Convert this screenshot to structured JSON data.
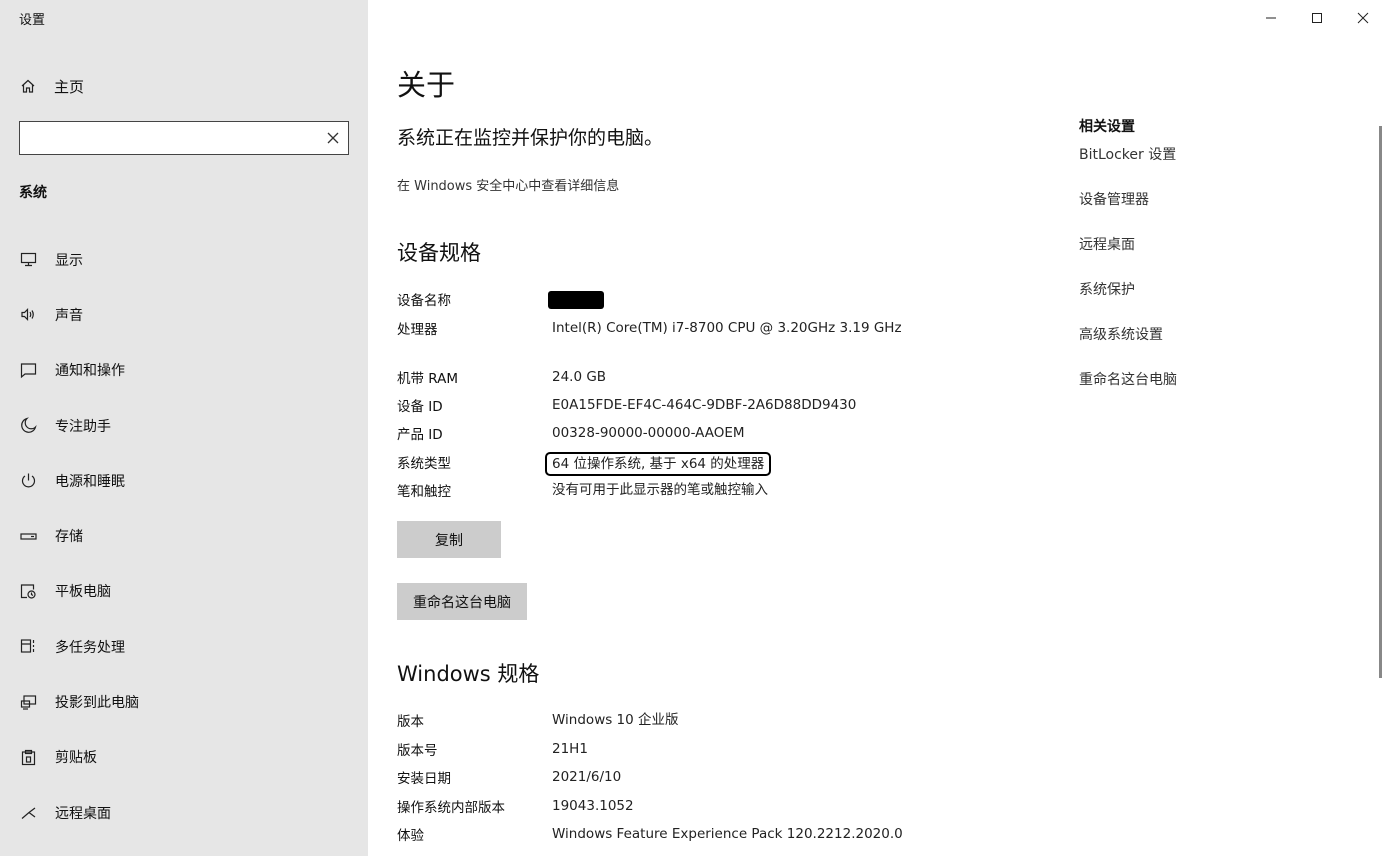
{
  "window": {
    "title": "设置"
  },
  "sidebar": {
    "home_label": "主页",
    "search_value": "",
    "section_title": "系统",
    "items": [
      {
        "label": "显示",
        "icon": "monitor-icon"
      },
      {
        "label": "声音",
        "icon": "speaker-icon"
      },
      {
        "label": "通知和操作",
        "icon": "notification-icon"
      },
      {
        "label": "专注助手",
        "icon": "moon-icon"
      },
      {
        "label": "电源和睡眠",
        "icon": "power-icon"
      },
      {
        "label": "存储",
        "icon": "storage-icon"
      },
      {
        "label": "平板电脑",
        "icon": "tablet-icon"
      },
      {
        "label": "多任务处理",
        "icon": "multitask-icon"
      },
      {
        "label": "投影到此电脑",
        "icon": "project-icon"
      },
      {
        "label": "剪贴板",
        "icon": "clipboard-icon"
      },
      {
        "label": "远程桌面",
        "icon": "remote-desktop-icon"
      }
    ]
  },
  "main": {
    "title": "关于",
    "headline": "系统正在监控并保护你的电脑。",
    "security_link": "在 Windows 安全中心中查看详细信息",
    "device_specs": {
      "heading": "设备规格",
      "rows": [
        {
          "key": "设备名称",
          "value": ""
        },
        {
          "key": "处理器",
          "value": "Intel(R) Core(TM) i7-8700 CPU @ 3.20GHz   3.19 GHz"
        },
        {
          "key": "机带 RAM",
          "value": "24.0 GB"
        },
        {
          "key": "设备 ID",
          "value": "E0A15FDE-EF4C-464C-9DBF-2A6D88DD9430"
        },
        {
          "key": "产品 ID",
          "value": "00328-90000-00000-AAOEM"
        },
        {
          "key": "系统类型",
          "value": "64 位操作系统, 基于 x64 的处理器"
        },
        {
          "key": "笔和触控",
          "value": "没有可用于此显示器的笔或触控输入"
        }
      ],
      "copy_button": "复制",
      "rename_button": "重命名这台电脑"
    },
    "windows_specs": {
      "heading": "Windows 规格",
      "rows": [
        {
          "key": "版本",
          "value": "Windows 10 企业版"
        },
        {
          "key": "版本号",
          "value": "21H1"
        },
        {
          "key": "安装日期",
          "value": "2021/6/10"
        },
        {
          "key": "操作系统内部版本",
          "value": "19043.1052"
        },
        {
          "key": "体验",
          "value": "Windows Feature Experience Pack 120.2212.2020.0"
        }
      ]
    }
  },
  "related": {
    "title": "相关设置",
    "links": [
      "BitLocker 设置",
      "设备管理器",
      "远程桌面",
      "系统保护",
      "高级系统设置",
      "重命名这台电脑"
    ]
  }
}
